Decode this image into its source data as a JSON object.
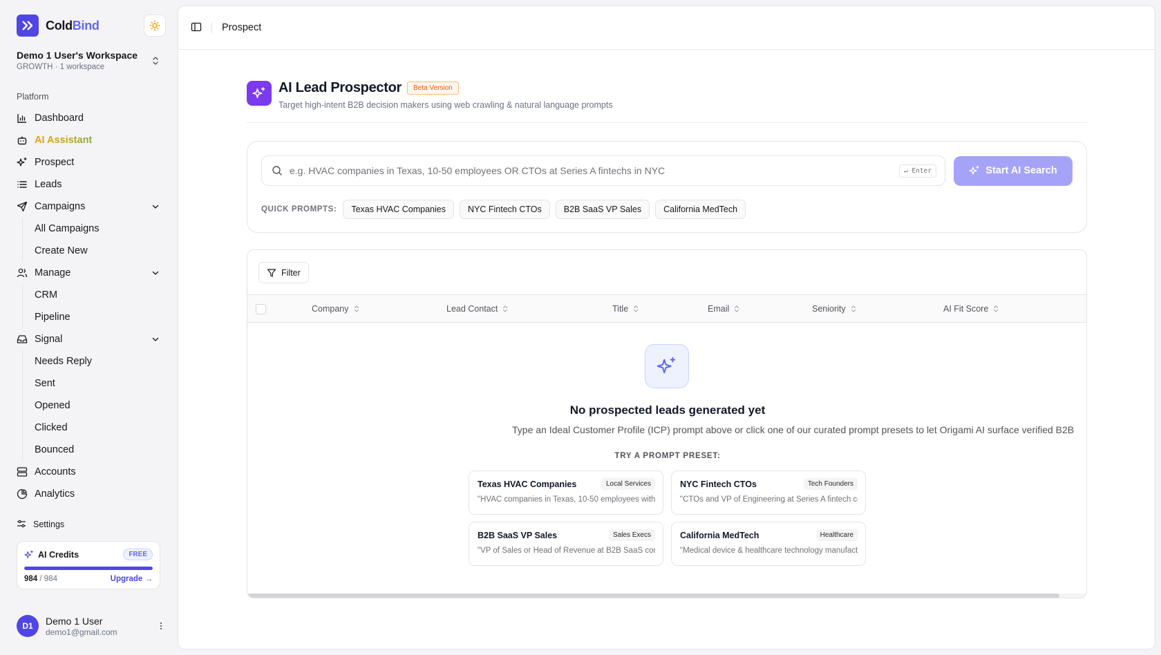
{
  "brand": {
    "name_part1": "Cold",
    "name_part2": "Bind"
  },
  "workspace": {
    "name": "Demo 1 User's Workspace",
    "plan": "GROWTH · 1 workspace"
  },
  "sidebar": {
    "section_label": "Platform",
    "items": [
      {
        "label": "Dashboard"
      },
      {
        "label": "AI Assistant"
      },
      {
        "label": "Prospect"
      },
      {
        "label": "Leads"
      },
      {
        "label": "Campaigns",
        "children": [
          "All Campaigns",
          "Create New"
        ]
      },
      {
        "label": "Manage",
        "children": [
          "CRM",
          "Pipeline"
        ]
      },
      {
        "label": "Signal",
        "children": [
          "Needs Reply",
          "Sent",
          "Opened",
          "Clicked",
          "Bounced"
        ]
      },
      {
        "label": "Accounts"
      },
      {
        "label": "Analytics"
      }
    ],
    "settings_label": "Settings"
  },
  "credits": {
    "title": "AI Credits",
    "badge": "FREE",
    "used": "984",
    "total": "/ 984",
    "fill_fraction": 1.0,
    "upgrade_label": "Upgrade →"
  },
  "user": {
    "initials": "D1",
    "name": "Demo 1 User",
    "email": "demo1@gmail.com"
  },
  "topbar": {
    "breadcrumb": "Prospect"
  },
  "page": {
    "title": "AI Lead Prospector",
    "badge": "Beta Version",
    "subtitle": "Target high-intent B2B decision makers using web crawling & natural language prompts"
  },
  "search": {
    "placeholder": "e.g. HVAC companies in Texas, 10-50 employees OR CTOs at Series A fintechs in NYC",
    "value": "",
    "kbd_hint": "↵ Enter",
    "button_label": "Start AI Search",
    "quick_prompts_label": "QUICK PROMPTS:",
    "quick_prompts": [
      "Texas HVAC Companies",
      "NYC Fintech CTOs",
      "B2B SaaS VP Sales",
      "California MedTech"
    ]
  },
  "table": {
    "filter_label": "Filter",
    "columns": [
      "Company",
      "Lead Contact",
      "Title",
      "Email",
      "Seniority",
      "AI Fit Score"
    ]
  },
  "empty_state": {
    "title": "No prospected leads generated yet",
    "description": "Type an Ideal Customer Profile (ICP) prompt above or click one of our curated prompt presets to let Origami AI surface verified B2B",
    "preset_label": "TRY A PROMPT PRESET:",
    "presets": [
      {
        "title": "Texas HVAC Companies",
        "tag": "Local Services",
        "desc": "\"HVAC companies in Texas, 10-50 employees with C"
      },
      {
        "title": "NYC Fintech CTOs",
        "tag": "Tech Founders",
        "desc": "\"CTOs and VP of Engineering at Series A fintech co"
      },
      {
        "title": "B2B SaaS VP Sales",
        "tag": "Sales Execs",
        "desc": "\"VP of Sales or Head of Revenue at B2B SaaS comp"
      },
      {
        "title": "California MedTech",
        "tag": "Healthcare",
        "desc": "\"Medical device & healthcare technology manufactu"
      }
    ]
  },
  "colors": {
    "accent": "#4f46e5",
    "purple": "#7c3aed",
    "button_disabled": "#a5a3f8",
    "beta": "#ea580c"
  }
}
